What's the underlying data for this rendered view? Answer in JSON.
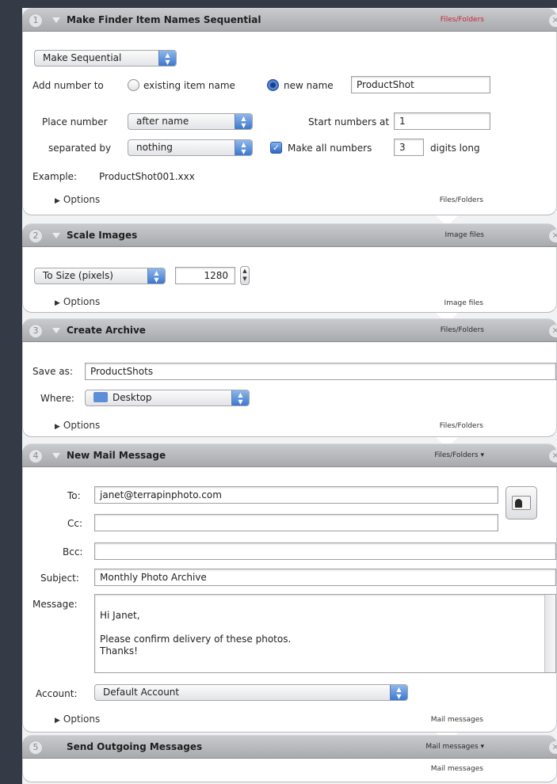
{
  "actions": [
    {
      "number": "1",
      "title": "Make Finder Item Names Sequential",
      "type_label": "Files/Folders",
      "mode": "Make Sequential",
      "add_number_to_label": "Add number to",
      "radio_existing_label": "existing item name",
      "radio_new_label": "new name",
      "new_name_value": "ProductShot",
      "place_number_label": "Place number",
      "place_number_value": "after name",
      "start_numbers_label": "Start numbers at",
      "start_numbers_value": "1",
      "separated_by_label": "separated by",
      "separated_by_value": "nothing",
      "make_all_label": "Make all numbers",
      "digits_value": "3",
      "digits_long_label": "digits long",
      "example_label": "Example:",
      "example_value": "ProductShot001.xxx",
      "options_label": "Options",
      "output_type": "Files/Folders"
    },
    {
      "number": "2",
      "title": "Scale Images",
      "type_label": "Image files",
      "scale_mode": "To Size (pixels)",
      "size_value": "1280",
      "options_label": "Options",
      "output_type": "Image files"
    },
    {
      "number": "3",
      "title": "Create Archive",
      "type_label": "Files/Folders",
      "save_as_label": "Save as:",
      "save_as_value": "ProductShots",
      "where_label": "Where:",
      "where_value": "Desktop",
      "options_label": "Options",
      "output_type": "Files/Folders"
    },
    {
      "number": "4",
      "title": "New Mail Message",
      "type_label": "Files/Folders ▾",
      "to_label": "To:",
      "to_value": "janet@terrapinphoto.com",
      "cc_label": "Cc:",
      "bcc_label": "Bcc:",
      "subject_label": "Subject:",
      "subject_value": "Monthly Photo Archive",
      "message_label": "Message:",
      "message_value": "Hi Janet,\n\nPlease confirm delivery of these photos.\nThanks!",
      "account_label": "Account:",
      "account_value": "Default Account",
      "options_label": "Options",
      "output_type": "Mail messages"
    },
    {
      "number": "5",
      "title": "Send Outgoing Messages",
      "type_label": "Mail messages ▾",
      "output_type": "Mail messages"
    }
  ],
  "colors": {
    "background": "#353b46",
    "header": "#b6b7bb",
    "accent_blue": "#3c78d0",
    "type_red": "#c4283a"
  }
}
